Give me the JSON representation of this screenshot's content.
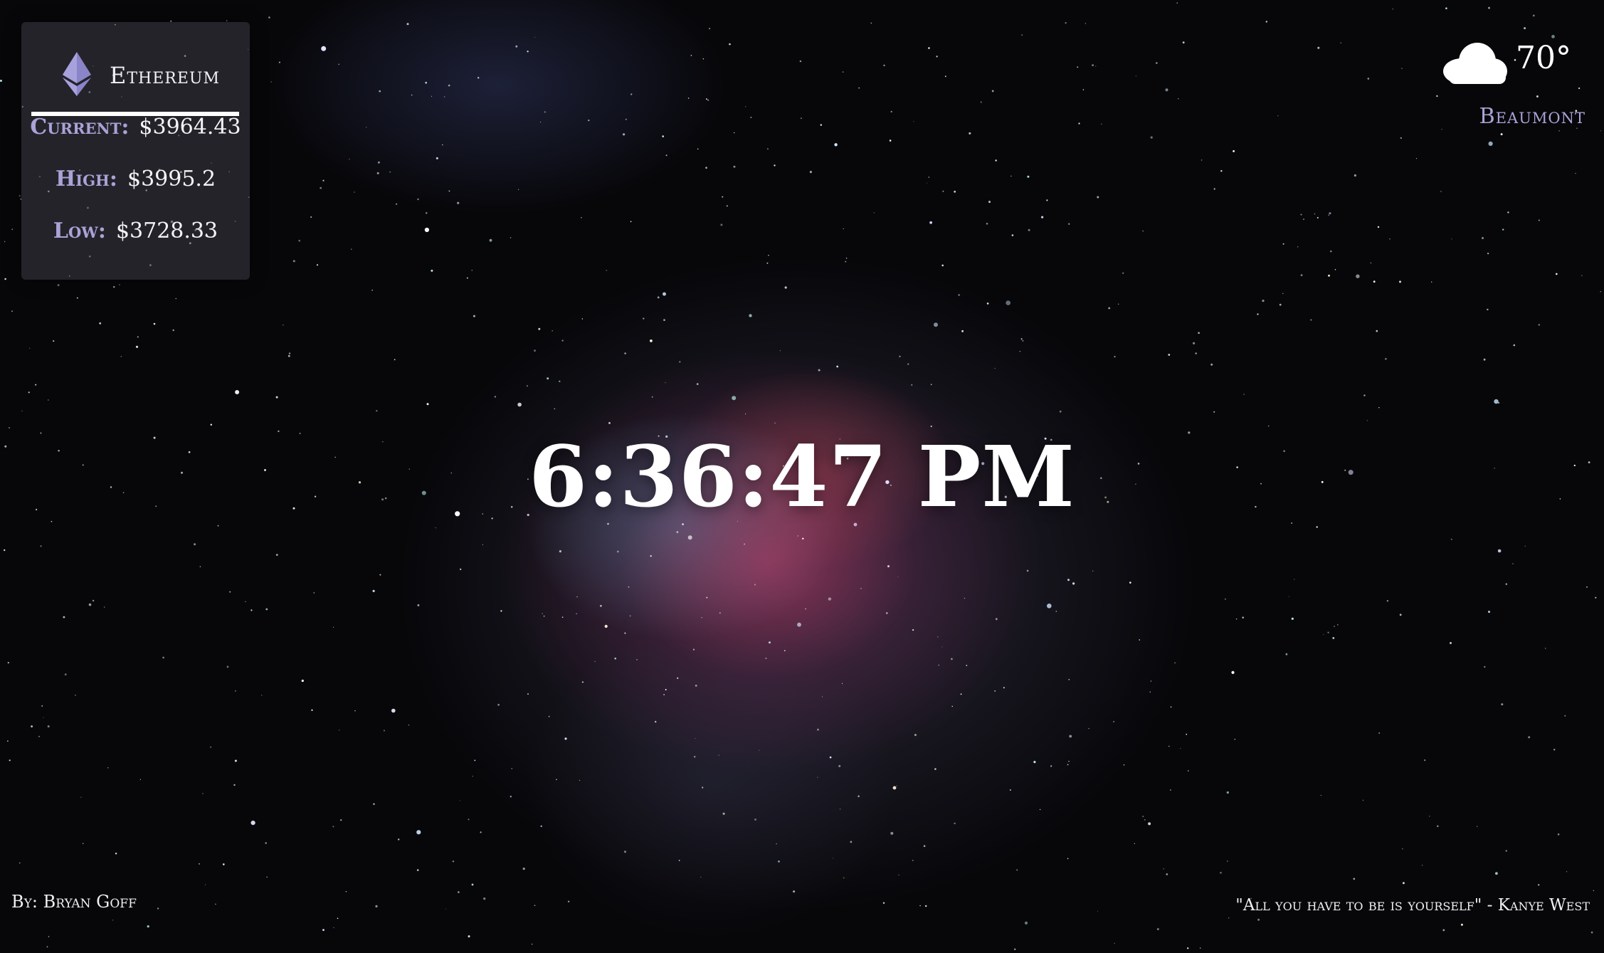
{
  "crypto": {
    "coin": "Ethereum",
    "coin_icon": "ethereum-icon",
    "rows": [
      {
        "label": "Current:",
        "value": "$3964.43"
      },
      {
        "label": "High:",
        "value": "$3995.2"
      },
      {
        "label": "Low:",
        "value": "$3728.33"
      }
    ]
  },
  "clock": {
    "time": "6:36:47 PM"
  },
  "weather": {
    "icon": "cloud-icon",
    "temperature": "70°",
    "city": "Beaumont"
  },
  "footer": {
    "credit": "By: Bryan Goff",
    "quote": "\"All you have to be is yourself\" - Kanye West"
  },
  "colors": {
    "accent": "#a9a3d6",
    "text": "#ffffff",
    "panel": "#3c3a46"
  }
}
